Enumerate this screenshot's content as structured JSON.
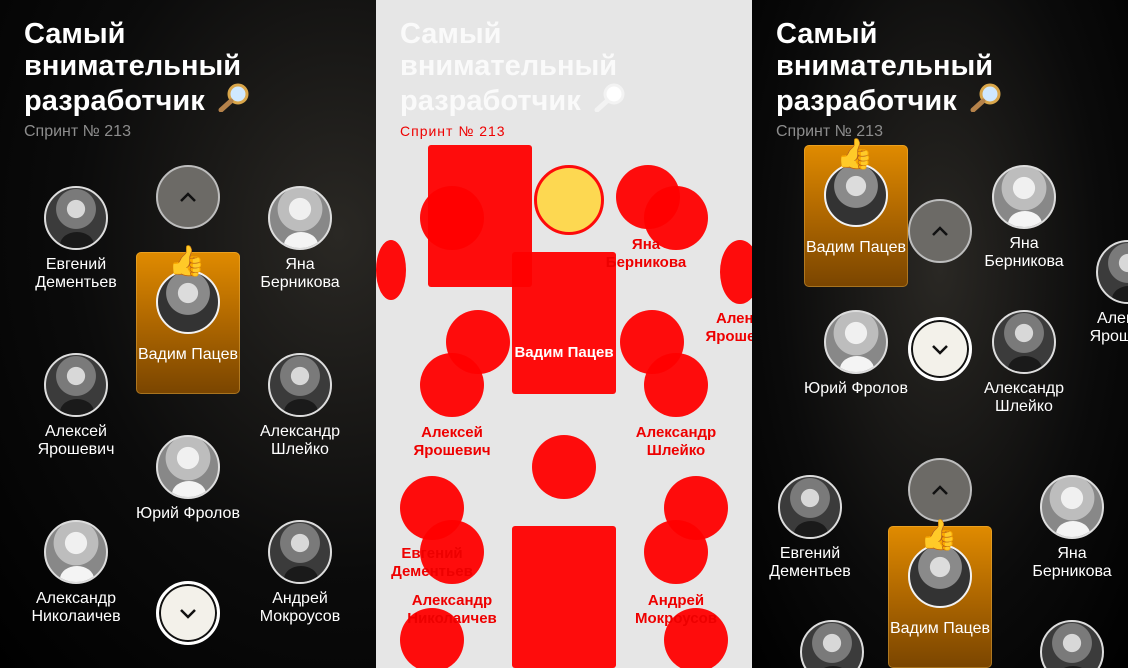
{
  "header": {
    "title": "Самый внимательный разработчик",
    "loupe_icon": "magnifier-icon",
    "subtitle": "Спринт № 213"
  },
  "panel1": {
    "people": [
      {
        "name": "Евгений Дементьев"
      },
      {
        "name": "Яна Берникова"
      },
      {
        "name": "Алексей Ярошевич"
      },
      {
        "name": "Александр Шлейко"
      },
      {
        "name": "Юрий Фролов"
      },
      {
        "name": "Александр Николаичев"
      },
      {
        "name": "Андрей Мокроусов"
      }
    ],
    "winner": {
      "name": "Вадим Пацев",
      "badge": "👍"
    }
  },
  "panel2": {
    "labels": [
      {
        "text": "Яна Берникова"
      },
      {
        "text": "Алений Ярошевич"
      },
      {
        "text": "Вадим Пацев"
      },
      {
        "text": "Алексей Ярошевич"
      },
      {
        "text": "Александр Шлейко"
      },
      {
        "text": "Евгений Дементьев"
      },
      {
        "text": "Александр Николаичев"
      },
      {
        "text": "Андрей Мокроусов"
      }
    ]
  },
  "panel3": {
    "top_winner": {
      "name": "Вадим Пацев",
      "badge": "👍"
    },
    "top_people": [
      {
        "name": "Яна Берникова"
      },
      {
        "name": "Алексей Ярошевич"
      },
      {
        "name": "Юрий Фролов"
      },
      {
        "name": "Александр Шлейко"
      }
    ],
    "bottom_people": [
      {
        "name": "Евгений Дементьев"
      },
      {
        "name": "Яна Берникова"
      }
    ],
    "bottom_winner": {
      "name": "Вадим Пацев",
      "badge": "👍"
    }
  },
  "colors": {
    "accent": "#e08b00",
    "diff": "#ff0000"
  }
}
